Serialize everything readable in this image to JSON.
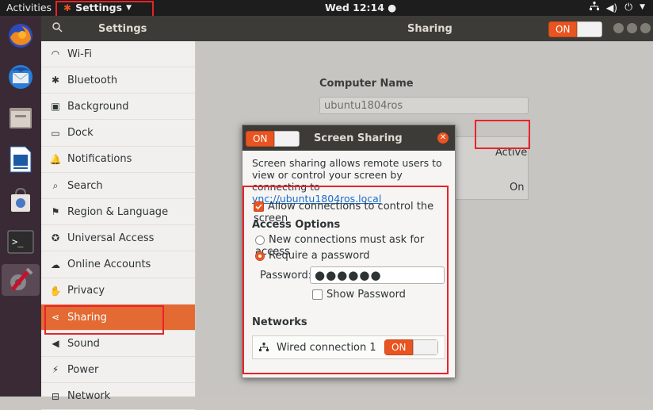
{
  "topbar": {
    "activities": "Activities",
    "app_menu": "Settings",
    "clock": "Wed 12:14 ●"
  },
  "dock": {
    "apps": [
      "firefox-icon",
      "thunderbird-icon",
      "files-icon",
      "libreoffice-writer-icon",
      "software-center-icon",
      "terminal-icon",
      "settings-icon"
    ]
  },
  "headerbar": {
    "left_title": "Settings",
    "title": "Sharing",
    "toggle_label": "ON"
  },
  "sidebar": {
    "items": [
      {
        "label": "Wi-Fi",
        "icon": "wifi-icon"
      },
      {
        "label": "Bluetooth",
        "icon": "bluetooth-icon"
      },
      {
        "label": "Background",
        "icon": "background-icon"
      },
      {
        "label": "Dock",
        "icon": "dock-icon"
      },
      {
        "label": "Notifications",
        "icon": "bell-icon"
      },
      {
        "label": "Search",
        "icon": "search-icon"
      },
      {
        "label": "Region & Language",
        "icon": "region-icon"
      },
      {
        "label": "Universal Access",
        "icon": "accessibility-icon"
      },
      {
        "label": "Online Accounts",
        "icon": "online-accounts-icon"
      },
      {
        "label": "Privacy",
        "icon": "hand-icon"
      },
      {
        "label": "Sharing",
        "icon": "share-icon"
      },
      {
        "label": "Sound",
        "icon": "speaker-icon"
      },
      {
        "label": "Power",
        "icon": "power-icon"
      },
      {
        "label": "Network",
        "icon": "network-icon"
      }
    ],
    "selected": "Sharing"
  },
  "main": {
    "computer_name_label": "Computer Name",
    "computer_name_value": "ubuntu1804ros",
    "rows": [
      {
        "status": "Active"
      },
      {
        "status": "On"
      }
    ]
  },
  "dialog": {
    "title": "Screen Sharing",
    "toggle_label": "ON",
    "description": "Screen sharing allows remote users to view or control your screen by connecting to ",
    "link": "vnc://ubuntu1804ros.local",
    "allow_control_label": "Allow connections to control the screen",
    "access_options_heading": "Access Options",
    "radio_ask": "New connections must ask for access",
    "radio_password": "Require a password",
    "password_label": "Password:",
    "password_value": "●●●●●●",
    "show_password_label": "Show Password",
    "networks_heading": "Networks",
    "network_name": "Wired connection 1",
    "network_toggle_label": "ON"
  },
  "colors": {
    "accent": "#e95420",
    "annotation": "#e8232a",
    "headerbar": "#3c3b37"
  }
}
